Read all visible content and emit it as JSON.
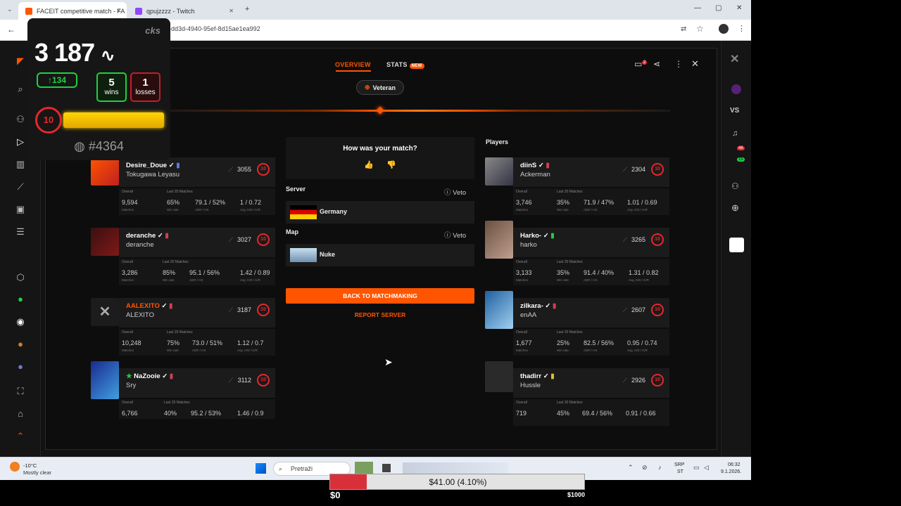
{
  "browser": {
    "tabs": [
      {
        "title": "FACEIT competitive match - FA"
      },
      {
        "title": "qpujzzzz - Twitch"
      }
    ],
    "new_tab": "+",
    "url": "1e-dd3d-4940-95ef-8d15ae1ea992"
  },
  "header": {
    "tabs": [
      {
        "label": "OVERVIEW"
      },
      {
        "label": "STATS"
      }
    ],
    "new_badge": "NEW",
    "chat_count": "2",
    "mode": "Veteran"
  },
  "team_left": [
    {
      "name": "Desire_Doue",
      "nickname": "Tokugawa Leyasu",
      "elo": "3055",
      "level": "10",
      "stats": {
        "matches": "9,594",
        "winrate": "65%",
        "adr_hs": "79.1 / 52%",
        "kd_kr": "1 / 0.72"
      }
    },
    {
      "name": "deranche",
      "nickname": "deranche",
      "elo": "3027",
      "level": "10",
      "stats": {
        "matches": "3,286",
        "winrate": "85%",
        "adr_hs": "95.1 / 56%",
        "kd_kr": "1.42 / 0.89"
      }
    },
    {
      "name": "AALEXITO",
      "nickname": "ALEXITO",
      "elo": "3187",
      "level": "10",
      "stats": {
        "matches": "10,248",
        "winrate": "75%",
        "adr_hs": "73.0 / 51%",
        "kd_kr": "1.12 / 0.7"
      }
    },
    {
      "name": "NaZooie",
      "nickname": "Sry",
      "elo": "3112",
      "level": "10",
      "stats": {
        "matches": "6,766",
        "winrate": "40%",
        "adr_hs": "95.2 / 53%",
        "kd_kr": "1.46 / 0.9"
      }
    }
  ],
  "team_right": [
    {
      "name": "diinS",
      "nickname": "Ackerman",
      "elo": "2304",
      "level": "10",
      "stats": {
        "matches": "3,746",
        "winrate": "35%",
        "adr_hs": "71.9 / 47%",
        "kd_kr": "1.01 / 0.69"
      }
    },
    {
      "name": "Harko-",
      "nickname": "harko",
      "elo": "3265",
      "level": "10",
      "stats": {
        "matches": "3,133",
        "winrate": "35%",
        "adr_hs": "91.4 / 40%",
        "kd_kr": "1.31 / 0.82"
      }
    },
    {
      "name": "zilkara-",
      "nickname": "enAA",
      "elo": "2607",
      "level": "10",
      "stats": {
        "matches": "1,677",
        "winrate": "25%",
        "adr_hs": "82.5 / 56%",
        "kd_kr": "0.95 / 0.74"
      }
    },
    {
      "name": "thadirr",
      "nickname": "Hussle",
      "elo": "2926",
      "level": "10",
      "stats": {
        "matches": "719",
        "winrate": "45%",
        "adr_hs": "69.4 / 56%",
        "kd_kr": "0.91 / 0.66"
      }
    }
  ],
  "stat_labels": {
    "overall": "Overall",
    "last20": "Last 20 Matches",
    "matches": "Matches",
    "winrate": "Win rate",
    "adr_hs": "ADR / HS",
    "kd_kr": "Avg. K/D / K/R"
  },
  "players_label": "Players",
  "center": {
    "rate_title": "How was your match?",
    "server_label": "Server",
    "server_value": "Germany",
    "map_label": "Map",
    "map_value": "Nuke",
    "veto_label": "Veto",
    "back_button": "BACK TO MATCHMAKING",
    "report_button": "REPORT SERVER"
  },
  "overlay": {
    "logo": "cks",
    "elo": "3 187",
    "gain": "134",
    "wins": "5",
    "wins_label": "wins",
    "losses": "1",
    "losses_label": "losses",
    "level": "10",
    "rank": "#4364"
  },
  "taskbar": {
    "temp": "-10°C",
    "weather": "Mostly clear",
    "search": "Pretraži",
    "lang1": "SRP",
    "lang2": "ST",
    "time": "06:32",
    "date": "9.1.2026."
  },
  "donation": {
    "text": "$41.00 (4.10%)",
    "progress": 0.041,
    "min": "$0",
    "max": "$1000"
  },
  "colors": {
    "accent": "#ff5500",
    "level_red": "#e8262b",
    "win_green": "#1fd140",
    "loss_red": "#c0202a"
  }
}
